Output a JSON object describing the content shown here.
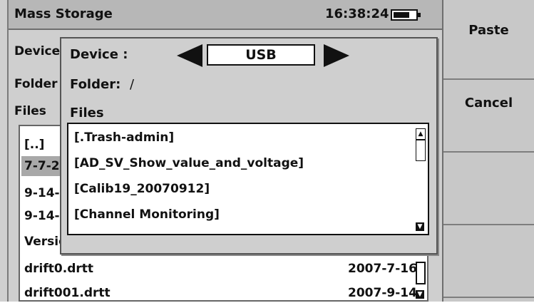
{
  "header": {
    "title": "Mass Storage",
    "time": "16:38:24",
    "battery_icon": "battery-icon"
  },
  "background": {
    "device_label": "Device",
    "folder_label": "Folder",
    "files_label": "Files",
    "rows": [
      {
        "name": "[..]",
        "date": ""
      },
      {
        "name": "7-7-2",
        "date": ""
      },
      {
        "name": "9-14-",
        "date": ""
      },
      {
        "name": "9-14-",
        "date": ""
      },
      {
        "name": "Versio",
        "date": ""
      },
      {
        "name": "drift0.drtt",
        "date": "2007-7-16"
      },
      {
        "name": "drift001.drtt",
        "date": "2007-9-14"
      }
    ]
  },
  "dialog": {
    "device_label": "Device :",
    "device_value": "USB",
    "folder_label": "Folder:",
    "folder_value": "/",
    "files_label": "Files",
    "files": [
      "[.Trash-admin]",
      "[AD_SV_Show_value_and_voltage]",
      "[Calib19_20070912]",
      "[Channel Monitoring]"
    ]
  },
  "softkeys": [
    "Paste",
    "Cancel",
    "",
    ""
  ]
}
